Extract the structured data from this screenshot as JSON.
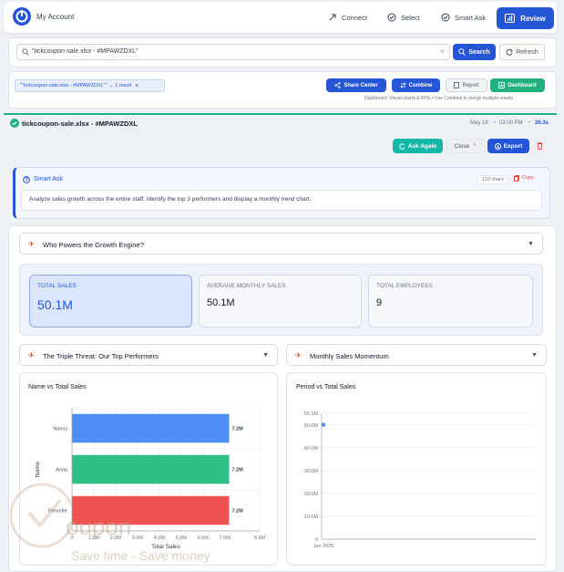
{
  "header": {
    "account": "My Account",
    "nav": [
      "Connect",
      "Select",
      "Smart Ask"
    ],
    "review": "Review"
  },
  "search": {
    "query": "\"tickcoupon-sale.xlsx - #MPAWZDXL\"",
    "search_label": "Search",
    "refresh_label": "Refresh"
  },
  "filter": {
    "chip": "\"\"tickcoupon-sale.xlsx - #MPAWZDXL\"\" → 1 result",
    "share_center": "Share Center",
    "combine": "Combine",
    "report": "Report",
    "dashboard": "Dashboard",
    "hint": "Dashboard: Visual charts & KPIs • Use Combine to merge multiple results"
  },
  "result": {
    "title": "tickcoupon-sale.xlsx - #MPAWZDXL",
    "date": "May 18",
    "time": "03:00 PM",
    "duration": "26.3s",
    "ask_again": "Ask Again",
    "close": "Close",
    "export": "Export"
  },
  "smart_ask": {
    "title": "Smart Ask",
    "chars": "110 chars",
    "copy": "Copy",
    "text": "Analyze sales growth across the entire staff. Identify the top 3 performers and display a monthly trend chart."
  },
  "sections": {
    "growth": "Who Powers the Growth Engine?",
    "top": "The Triple Threat: Our Top Performers",
    "momentum": "Monthly Sales Momentum"
  },
  "kpis": [
    {
      "label": "TOTAL SALES",
      "value": "50.1M"
    },
    {
      "label": "AVERAGE MONTHLY SALES",
      "value": "50.1M"
    },
    {
      "label": "TOTAL EMPLOYEES",
      "value": "9"
    }
  ],
  "colors": {
    "accent": "#2456d6",
    "teal": "#14b8a6",
    "green": "#22b07d",
    "bar_blue": "#4f8ef7",
    "bar_green": "#2dbf86",
    "bar_red": "#ef5350"
  },
  "watermark": {
    "brand": "oupon",
    "tagline": "Save time - Save money"
  },
  "chart_data": [
    {
      "type": "bar",
      "orientation": "horizontal",
      "title": "Name vs Total Sales",
      "xlabel": "Total Sales",
      "ylabel": "Name",
      "categories": [
        "Nancy",
        "Anna",
        "Gennifer"
      ],
      "values": [
        7200000,
        7200000,
        7200000
      ],
      "value_labels": [
        "7.2M",
        "7.2M",
        "7.2M"
      ],
      "colors": [
        "#4f8ef7",
        "#2dbf86",
        "#ef5350"
      ],
      "xlim": [
        0,
        8600000
      ],
      "xticks": [
        "0",
        "1.0M",
        "2.0M",
        "3.0M",
        "4.0M",
        "5.0M",
        "6.0M",
        "7.0M",
        "8.6M"
      ],
      "xtick_values": [
        0,
        1000000,
        2000000,
        3000000,
        4000000,
        5000000,
        6000000,
        7000000,
        8600000
      ],
      "grid": true
    },
    {
      "type": "line",
      "title": "Period vs Total Sales",
      "x": [
        "Jan 2026"
      ],
      "values": [
        50100000
      ],
      "ylim": [
        0,
        55100000
      ],
      "yticks": [
        "0",
        "10.0M",
        "20.0M",
        "30.0M",
        "40.0M",
        "50.0M",
        "55.1M"
      ],
      "ytick_values": [
        0,
        10000000,
        20000000,
        30000000,
        40000000,
        50000000,
        55100000
      ],
      "xticks": [
        "Jan 2026"
      ],
      "grid": true
    }
  ]
}
